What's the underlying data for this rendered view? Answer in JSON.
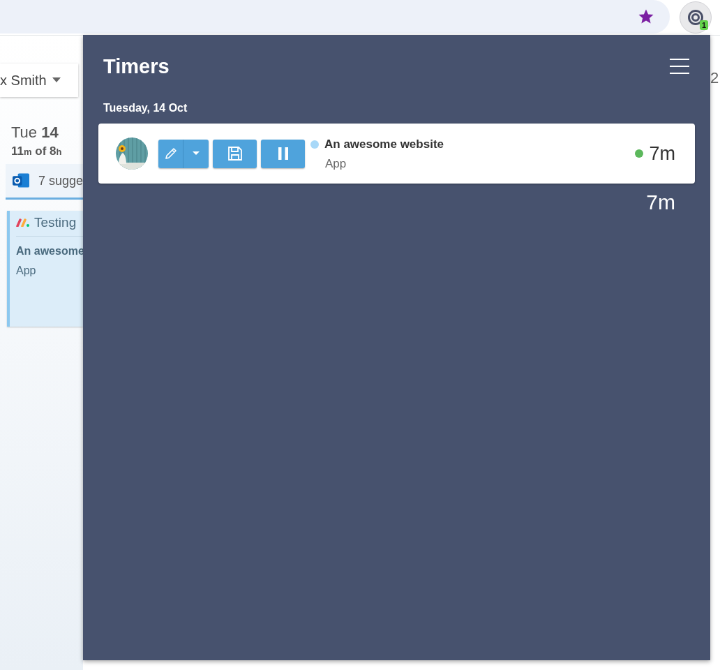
{
  "browser": {
    "extension_badge": "1"
  },
  "background": {
    "user_dropdown": "x Smith",
    "edge_text": "2",
    "day": {
      "weekday": "Tue",
      "date": "14"
    },
    "summary": [
      {
        "text": "11",
        "unit": false
      },
      {
        "text": "m",
        "unit": true
      },
      {
        "text": " of 8",
        "unit": false
      },
      {
        "text": "h",
        "unit": true
      }
    ],
    "suggestions": "7 sugge",
    "entry": {
      "title": "Testing",
      "project": "An awesome",
      "task": "App"
    }
  },
  "popup": {
    "title": "Timers",
    "date": "Tuesday, 14 Oct",
    "timers": [
      {
        "project": "An awesome website",
        "task": "App",
        "color": "#a8d8f8",
        "running": true,
        "duration": "7m",
        "kind": "picture"
      }
    ],
    "total": "7m"
  }
}
